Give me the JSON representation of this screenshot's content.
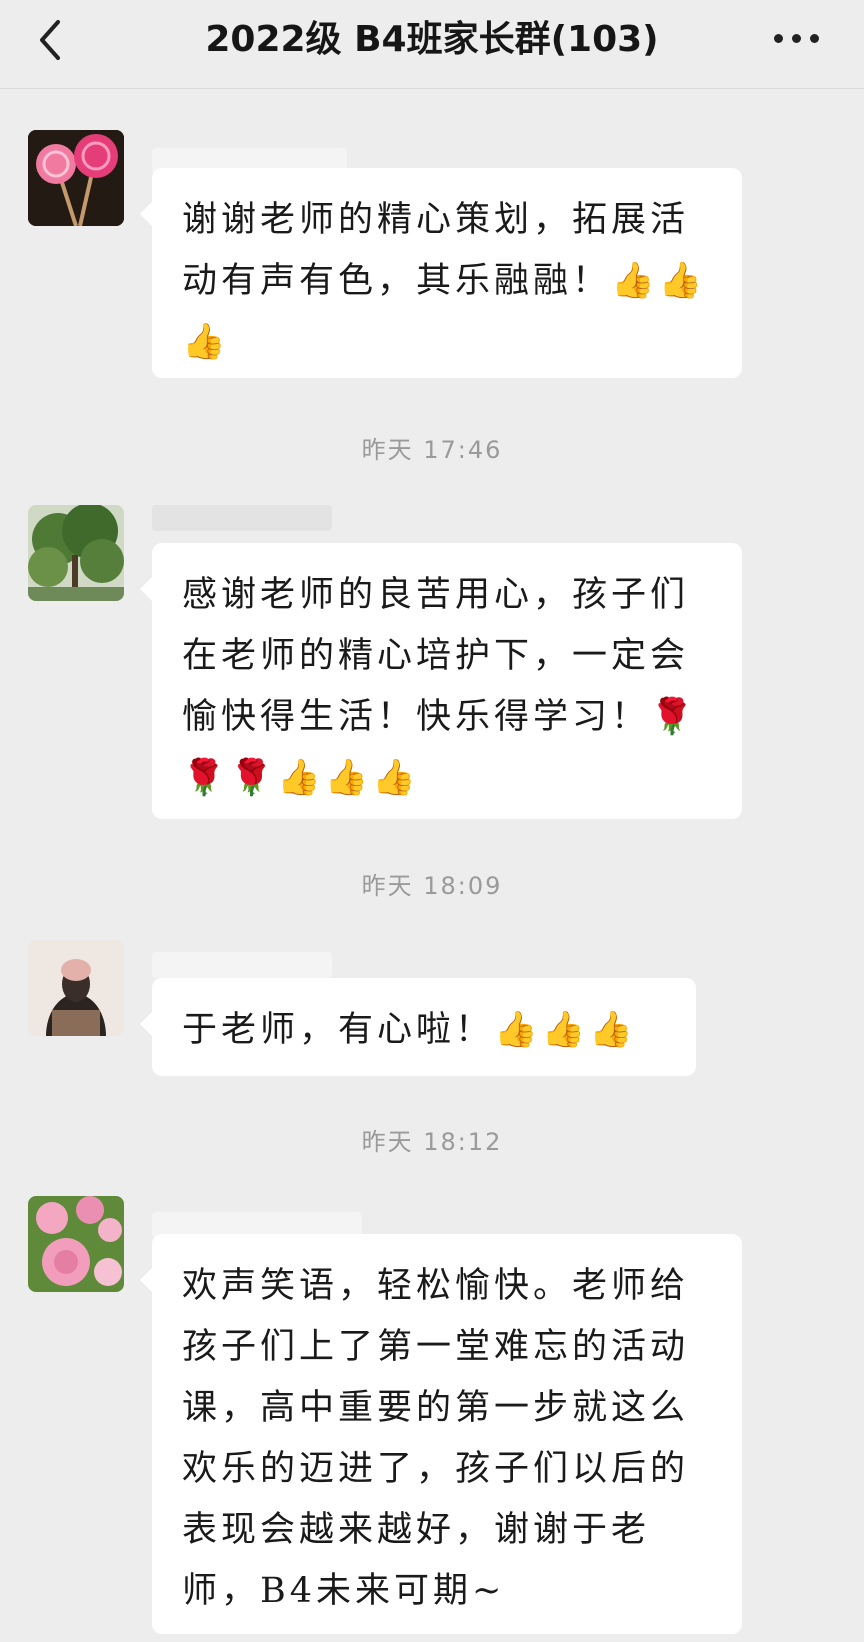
{
  "header": {
    "title": "2022级 B4班家长群(103)",
    "back_icon": "chevron-left-icon",
    "more_icon": "more-dots-icon"
  },
  "messages": [
    {
      "avatar": "lollipop-avatar",
      "text": "谢谢老师的精心策划，拓展活动有声有色，其乐融融！👍👍👍"
    },
    {
      "avatar": "tree-avatar",
      "text": "感谢老师的良苦用心，孩子们在老师的精心培护下，一定会愉快得生活！快乐得学习！🌹🌹🌹👍👍👍"
    },
    {
      "avatar": "girl-avatar",
      "text": "于老师，有心啦！👍👍👍"
    },
    {
      "avatar": "flower-avatar",
      "text": "欢声笑语，轻松愉快。老师给孩子们上了第一堂难忘的活动课，高中重要的第一步就这么欢乐的迈进了，孩子们以后的表现会越来越好，谢谢于老师，B4未来可期~"
    }
  ],
  "timestamps": [
    "昨天 17:46",
    "昨天 18:09",
    "昨天 18:12"
  ]
}
